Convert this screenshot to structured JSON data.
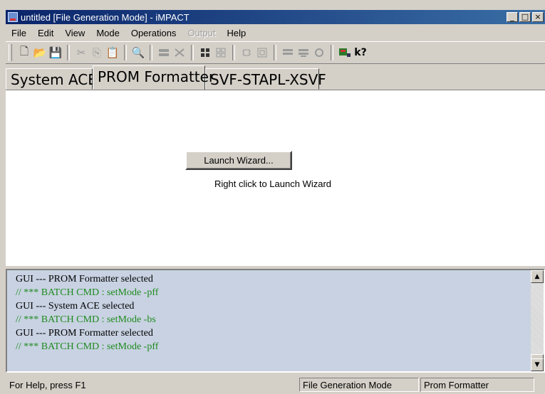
{
  "window": {
    "title": "untitled [File Generation Mode] - iMPACT",
    "minimize": "_",
    "maximize": "□",
    "close": "×"
  },
  "menu": [
    {
      "label": "File",
      "enabled": true
    },
    {
      "label": "Edit",
      "enabled": true
    },
    {
      "label": "View",
      "enabled": true
    },
    {
      "label": "Mode",
      "enabled": true
    },
    {
      "label": "Operations",
      "enabled": true
    },
    {
      "label": "Output",
      "enabled": false
    },
    {
      "label": "Help",
      "enabled": true
    }
  ],
  "toolbar": {
    "new": "🗋",
    "open": "📂",
    "save": "💾",
    "cut": "✂",
    "copy": "⎘",
    "paste": "📋",
    "find": "🔍",
    "help": "k?"
  },
  "tabs": [
    {
      "label": "System ACE",
      "active": false
    },
    {
      "label": "PROM Formatter",
      "active": true
    },
    {
      "label": "SVF-STAPL-XSVF",
      "active": false
    }
  ],
  "main": {
    "launch_button": "Launch Wizard...",
    "hint": "Right click to Launch Wizard"
  },
  "log": {
    "lines": [
      {
        "text": "GUI --- PROM Formatter selected",
        "type": "info"
      },
      {
        "text": "// *** BATCH CMD : setMode -pff",
        "type": "cmd"
      },
      {
        "text": "GUI --- System ACE selected",
        "type": "info"
      },
      {
        "text": "// *** BATCH CMD : setMode -bs",
        "type": "cmd"
      },
      {
        "text": "GUI --- PROM Formatter selected",
        "type": "info"
      },
      {
        "text": "// *** BATCH CMD : setMode -pff",
        "type": "cmd"
      }
    ]
  },
  "status": {
    "help": "For Help, press F1",
    "mode": "File Generation Mode",
    "panel": "Prom Formatter"
  },
  "colors": {
    "title_bar": "#0a246a",
    "log_background": "#c8d2e2",
    "command_text": "#1f8a1f"
  }
}
